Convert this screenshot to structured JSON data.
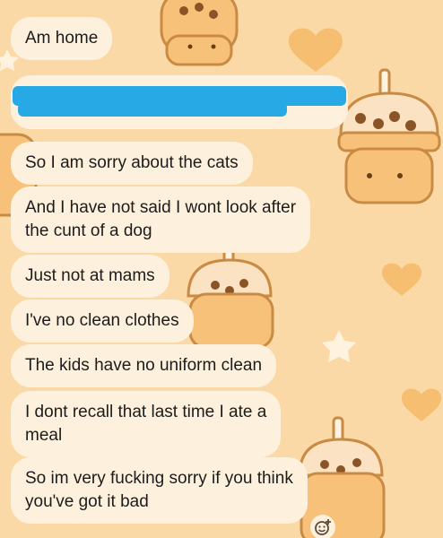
{
  "conversation": {
    "messages": [
      {
        "text": "Am home"
      },
      {
        "text": "",
        "redacted": true
      },
      {
        "text": "So I am sorry about the cats"
      },
      {
        "text": "And I have not said I wont look after\nthe cunt of a dog"
      },
      {
        "text": "Just not at mams"
      },
      {
        "text": "I've no clean clothes"
      },
      {
        "text": "The kids have no uniform clean"
      },
      {
        "text": "I dont recall that last time I ate a\nmeal"
      },
      {
        "text": "So im very fucking sorry if you think\nyou've got it bad"
      }
    ]
  },
  "theme": {
    "wallpaper_color": "#fbd9a6",
    "bubble_color": "#fdf0dc",
    "redaction_color": "#27a9e6",
    "text_color": "#1c1c1c"
  },
  "icons": {
    "react": "add-reaction-icon"
  }
}
